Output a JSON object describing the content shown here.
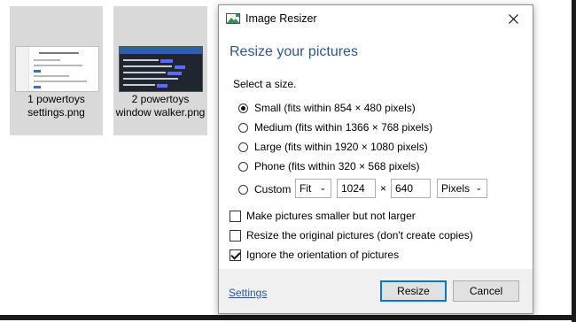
{
  "desktop": {
    "files": [
      {
        "name": "1 powertoys settings.png"
      },
      {
        "name": "2 powertoys window walker.png"
      }
    ]
  },
  "dialog": {
    "title": "Image Resizer",
    "heading": "Resize your pictures",
    "prompt": "Select a size.",
    "sizes": [
      {
        "label": "Small (fits within 854 × 480 pixels)",
        "selected": true
      },
      {
        "label": "Medium (fits within 1366 × 768 pixels)",
        "selected": false
      },
      {
        "label": "Large (fits within 1920 × 1080 pixels)",
        "selected": false
      },
      {
        "label": "Phone (fits within 320 × 568 pixels)",
        "selected": false
      },
      {
        "label": "Custom",
        "selected": false
      }
    ],
    "custom": {
      "fit_mode": "Fit",
      "width": "1024",
      "times": "×",
      "height": "640",
      "unit": "Pixels"
    },
    "options": [
      {
        "label": "Make pictures smaller but not larger",
        "checked": false
      },
      {
        "label": "Resize the original pictures (don't create copies)",
        "checked": false
      },
      {
        "label": "Ignore the orientation of pictures",
        "checked": true
      }
    ],
    "footer": {
      "settings_link": "Settings",
      "resize_button": "Resize",
      "cancel_button": "Cancel"
    }
  }
}
